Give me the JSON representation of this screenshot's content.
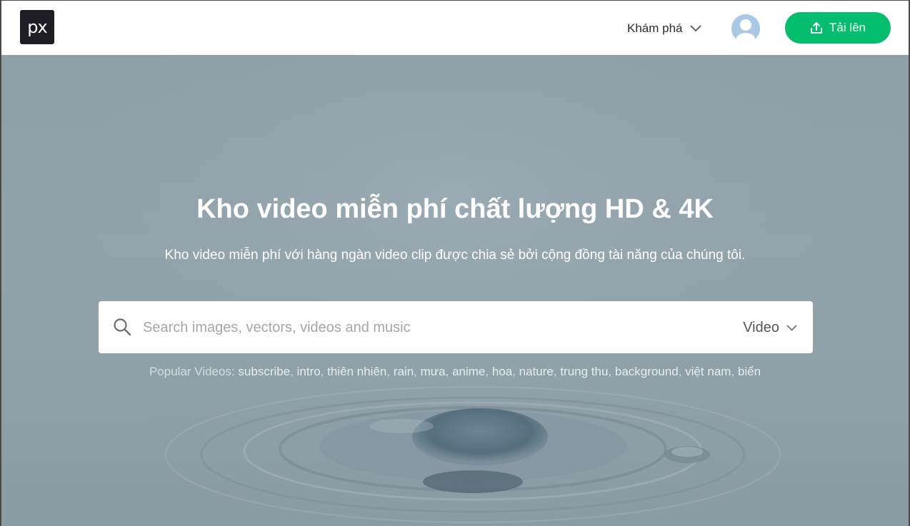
{
  "header": {
    "logo_text": "px",
    "explore_label": "Khám phá",
    "upload_label": "Tải lên"
  },
  "hero": {
    "title": "Kho video miễn phí chất lượng HD & 4K",
    "subtitle": "Kho video miễn phí với hàng ngàn video clip được chia sẻ bởi cộng đồng tài năng của chúng tôi."
  },
  "search": {
    "placeholder": "Search images, vectors, videos and music",
    "type_label": "Video"
  },
  "popular": {
    "label": "Popular Videos:",
    "tags": [
      "subscribe",
      "intro",
      "thiên nhiên",
      "rain",
      "mưa",
      "anime",
      "hoa",
      "nature",
      "trung thu",
      "background",
      "việt nam",
      "biển"
    ]
  },
  "colors": {
    "accent_green": "#02be6e",
    "logo_bg": "#1d1d23",
    "hero_bg": "#909fa8"
  },
  "icons": {
    "explore_chevron": "chevron-down-icon",
    "avatar": "user-avatar-icon",
    "upload": "upload-icon",
    "search": "search-icon",
    "type_chevron": "chevron-down-icon"
  }
}
